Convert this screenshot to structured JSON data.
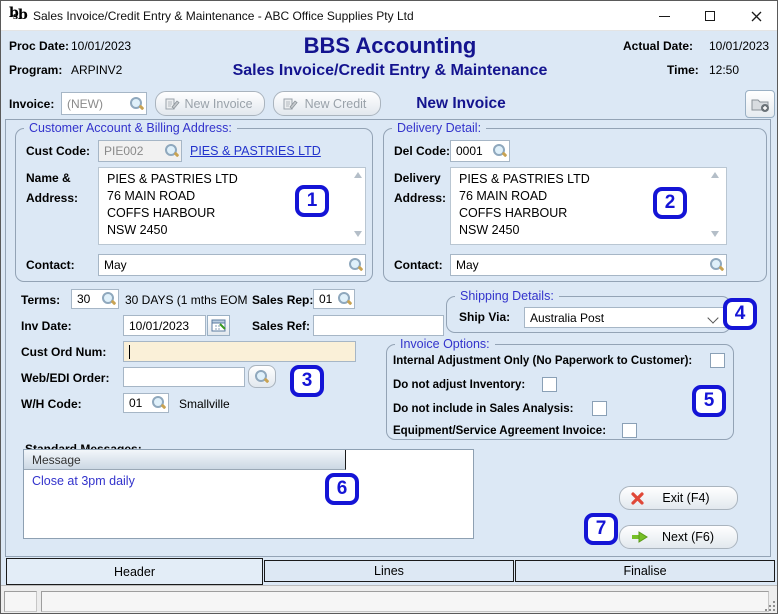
{
  "window": {
    "title": "Sales Invoice/Credit Entry & Maintenance - ABC Office Supplies Pty Ltd"
  },
  "icons": {
    "app_icon": "bbs-logo",
    "lookup": "magnifier-lookup",
    "calendar": "date-picker-calendar",
    "new_document": "document-with-pencil",
    "add_entry": "folder-with-plus",
    "exit": "red-cross",
    "next": "green-arrow-right",
    "dropdown": "chevron-down"
  },
  "header": {
    "proc_date_label": "Proc Date:",
    "proc_date_value": "10/01/2023",
    "program_label": "Program:",
    "program_value": "ARPINV2",
    "app_title": "BBS Accounting",
    "screen_title": "Sales Invoice/Credit Entry & Maintenance",
    "actual_date_label": "Actual Date:",
    "actual_date_value": "10/01/2023",
    "time_label": "Time:",
    "time_value": "12:50"
  },
  "invoice_bar": {
    "invoice_label": "Invoice:",
    "invoice_value": "(NEW)",
    "new_invoice_button": "New Invoice",
    "new_credit_button": "New Credit",
    "mode_status": "New Invoice"
  },
  "customer": {
    "group_title": "Customer Account & Billing Address:",
    "cust_code_label": "Cust Code:",
    "cust_code_value": "PIE002",
    "customer_link": "PIES & PASTRIES LTD",
    "name_address_label_line1": "Name &",
    "name_address_label_line2": "Address:",
    "address": "PIES & PASTRIES LTD\n76 MAIN ROAD\nCOFFS HARBOUR\nNSW 2450",
    "contact_label": "Contact:",
    "contact_value": "May"
  },
  "delivery": {
    "group_title": "Delivery Detail:",
    "del_code_label": "Del Code:",
    "del_code_value": "0001",
    "address_label_line1": "Delivery",
    "address_label_line2": "Address:",
    "address": "PIES & PASTRIES LTD\n76 MAIN ROAD\nCOFFS HARBOUR\nNSW 2450",
    "contact_label": "Contact:",
    "contact_value": "May"
  },
  "details": {
    "terms_label": "Terms:",
    "terms_value": "30",
    "terms_desc": "30 DAYS (1 mths EOM",
    "sales_rep_label": "Sales Rep:",
    "sales_rep_value": "01",
    "inv_date_label": "Inv Date:",
    "inv_date_value": "10/01/2023",
    "sales_ref_label": "Sales Ref:",
    "sales_ref_value": "",
    "cust_ord_label": "Cust Ord Num:",
    "cust_ord_value": "",
    "web_edi_label": "Web/EDI Order:",
    "web_edi_value": "",
    "wh_code_label": "W/H Code:",
    "wh_code_value": "01",
    "wh_name": "Smallville"
  },
  "shipping": {
    "group_title": "Shipping Details:",
    "ship_via_label": "Ship Via:",
    "ship_via_value": "Australia Post"
  },
  "invoice_options": {
    "group_title": "Invoice Options:",
    "options": [
      {
        "label": "Internal Adjustment Only (No Paperwork to Customer):",
        "checked": false
      },
      {
        "label": "Do not adjust Inventory:",
        "checked": false
      },
      {
        "label": "Do not include in Sales Analysis:",
        "checked": false
      },
      {
        "label": "Equipment/Service Agreement Invoice:",
        "checked": false
      }
    ]
  },
  "messages": {
    "section_label": "Standard Messages:",
    "column_header": "Message",
    "rows": [
      "Close at 3pm daily"
    ]
  },
  "actions": {
    "exit_label": "Exit (F4)",
    "next_label": "Next (F6)"
  },
  "tabs": [
    {
      "label": "Header",
      "active": true
    },
    {
      "label": "Lines",
      "active": false
    },
    {
      "label": "Finalise",
      "active": false
    }
  ],
  "annotations": [
    "1",
    "2",
    "3",
    "4",
    "5",
    "6",
    "7"
  ],
  "colors": {
    "background": "#dce8f5",
    "heading_navy": "#14148f",
    "group_caption_blue": "#3333cc",
    "link_blue": "#2233cc",
    "annotation_blue": "#1414d6",
    "message_text_blue": "#3333cc",
    "focused_field_cream": "#faf0d8"
  }
}
